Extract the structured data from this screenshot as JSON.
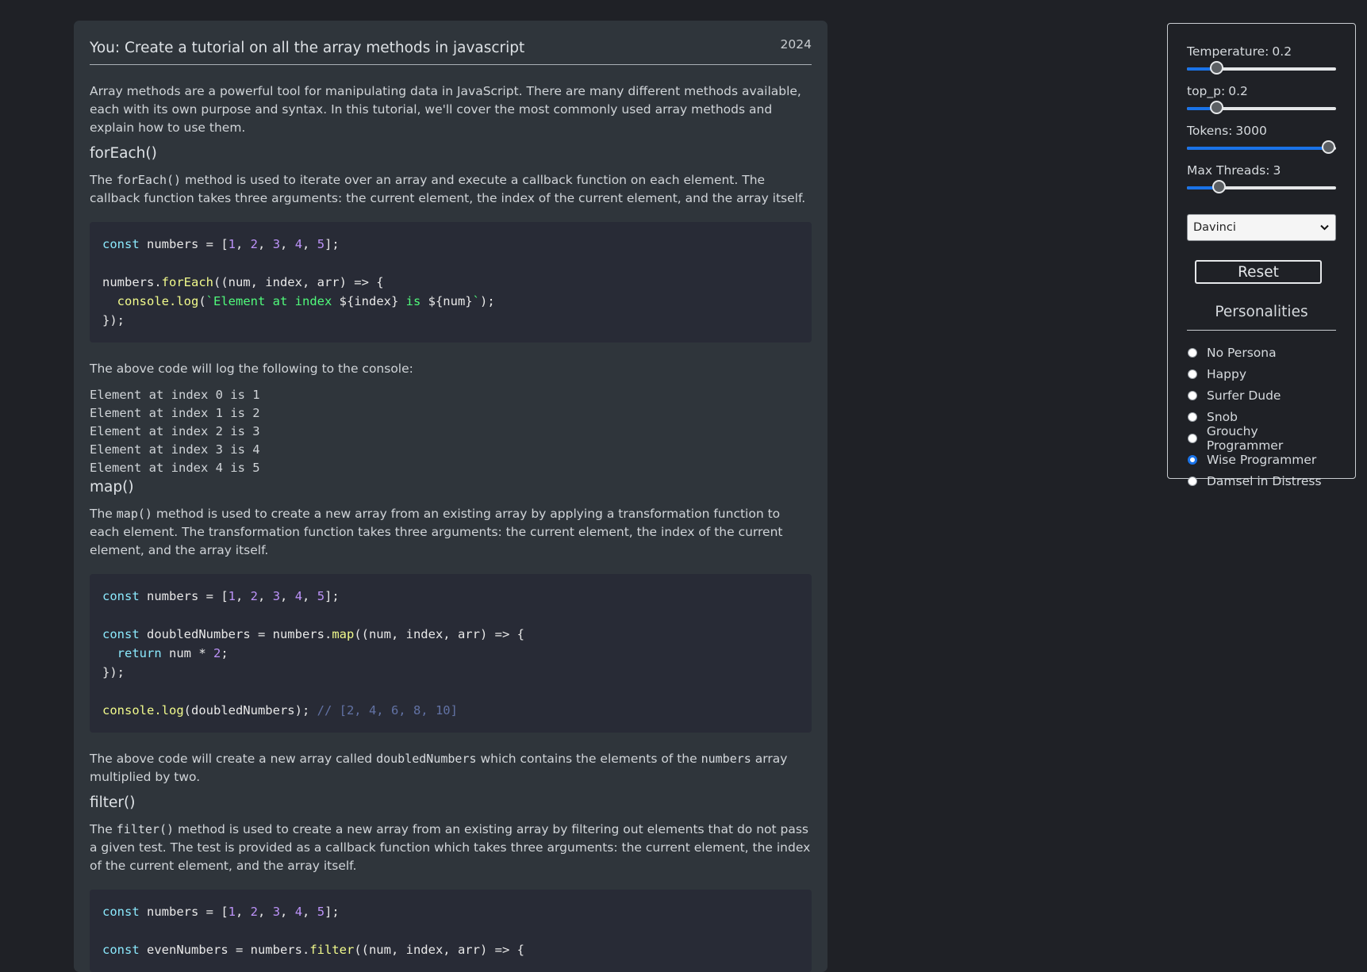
{
  "chat": {
    "title": "You: Create a tutorial on all the array methods in javascript",
    "year": "2024",
    "intro": "Array methods are a powerful tool for manipulating data in JavaScript. There are many different methods available, each with its own purpose and syntax. In this tutorial, we'll cover the most commonly used array methods and explain how to use them.",
    "sections": {
      "forEach": {
        "heading": "forEach()",
        "p_pre": "The ",
        "p_code": "forEach()",
        "p_post": " method is used to iterate over an array and execute a callback function on each element. The callback function takes three arguments: the current element, the index of the current element, and the array itself.",
        "after": "The above code will log the following to the console:",
        "output": [
          "Element at index 0 is 1",
          "Element at index 1 is 2",
          "Element at index 2 is 3",
          "Element at index 3 is 4",
          "Element at index 4 is 5"
        ]
      },
      "map": {
        "heading": "map()",
        "p_pre": "The ",
        "p_code": "map()",
        "p_post": " method is used to create a new array from an existing array by applying a transformation function to each element. The transformation function takes three arguments: the current element, the index of the current element, and the array itself.",
        "after_pre": "The above code will create a new array called ",
        "after_code1": "doubledNumbers",
        "after_mid": " which contains the elements of the ",
        "after_code2": "numbers",
        "after_post": " array multiplied by two."
      },
      "filter": {
        "heading": "filter()",
        "p_pre": "The ",
        "p_code": "filter()",
        "p_post": " method is used to create a new array from an existing array by filtering out elements that do not pass a given test. The test is provided as a callback function which takes three arguments: the current element, the index of the current element, and the array itself."
      }
    }
  },
  "settings": {
    "sliders": [
      {
        "label": "Temperature:",
        "value": "0.2",
        "level": 0.2
      },
      {
        "label": "top_p:",
        "value": "0.2",
        "level": 0.2
      },
      {
        "label": "Tokens:",
        "value": "3000",
        "level": 0.95
      },
      {
        "label": "Max Threads:",
        "value": "3",
        "level": 0.22
      }
    ],
    "model_select": "Davinci",
    "reset_label": "Reset",
    "personalities_title": "Personalities",
    "personalities": [
      "No Persona",
      "Happy",
      "Surfer Dude",
      "Snob",
      "Grouchy Programmer",
      "Wise Programmer",
      "Damsel in Distress"
    ],
    "selected_personality": "Wise Programmer"
  }
}
